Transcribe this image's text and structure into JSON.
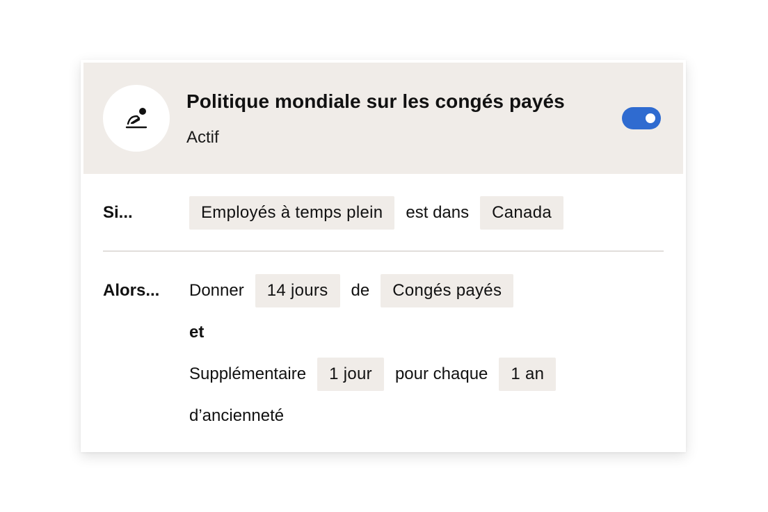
{
  "policy": {
    "icon": "person-resting-icon",
    "title": "Politique mondiale sur les congés payés",
    "status": "Actif",
    "toggle_on": true,
    "accent_color": "#2f6bd0"
  },
  "condition": {
    "label": "Si...",
    "group": "Employés à temps plein",
    "operator": "est dans",
    "country": "Canada"
  },
  "action": {
    "label": "Alors...",
    "give_word": "Donner",
    "days": "14 jours",
    "of_word": "de",
    "leave_type": "Congés payés",
    "and_word": "et",
    "extra_word": "Supplémentaire",
    "extra_days": "1 jour",
    "per_word": "pour chaque",
    "seniority_unit": "1 an",
    "seniority_word": "d’ancienneté"
  }
}
